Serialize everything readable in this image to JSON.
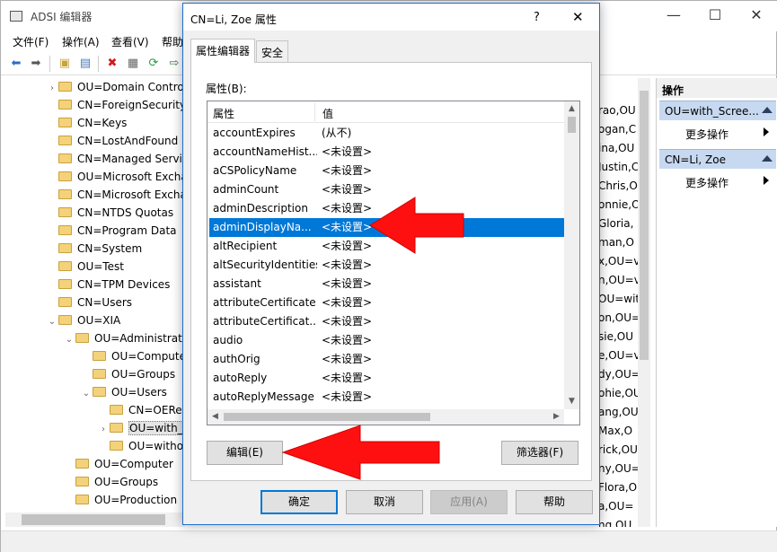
{
  "main_window": {
    "title": "ADSI 编辑器",
    "controls": {
      "minimize": "—",
      "maximize": "☐",
      "close": "✕"
    },
    "menu": [
      "文件(F)",
      "操作(A)",
      "查看(V)",
      "帮助"
    ]
  },
  "tree": {
    "items": [
      {
        "label": "OU=Domain Contro",
        "expand": "›"
      },
      {
        "label": "CN=ForeignSecurity",
        "expand": ""
      },
      {
        "label": "CN=Keys",
        "expand": ""
      },
      {
        "label": "CN=LostAndFound",
        "expand": ""
      },
      {
        "label": "CN=Managed Servi",
        "expand": ""
      },
      {
        "label": "OU=Microsoft Excha",
        "expand": ""
      },
      {
        "label": "CN=Microsoft Excha",
        "expand": ""
      },
      {
        "label": "CN=NTDS Quotas",
        "expand": ""
      },
      {
        "label": "CN=Program Data",
        "expand": ""
      },
      {
        "label": "CN=System",
        "expand": ""
      },
      {
        "label": "OU=Test",
        "expand": ""
      },
      {
        "label": "CN=TPM Devices",
        "expand": ""
      },
      {
        "label": "CN=Users",
        "expand": ""
      },
      {
        "label": "OU=XIA",
        "expand": "⌄"
      },
      {
        "label": "OU=Administratio",
        "expand": "⌄"
      },
      {
        "label": "OU=Compute",
        "expand": ""
      },
      {
        "label": "OU=Groups",
        "expand": ""
      },
      {
        "label": "OU=Users",
        "expand": "⌄"
      },
      {
        "label": "CN=OERe",
        "expand": ""
      },
      {
        "label": "OU=with_S",
        "expand": "›"
      },
      {
        "label": "OU=witho",
        "expand": ""
      },
      {
        "label": "OU=Computer",
        "expand": ""
      },
      {
        "label": "OU=Groups",
        "expand": ""
      },
      {
        "label": "OU=Production",
        "expand": ""
      }
    ]
  },
  "list": {
    "rows": [
      "rao,OU",
      "ogan,C",
      "ina,OU",
      "Justin,C",
      "Chris,OU",
      "onnie,O",
      "Gloria,",
      "man,O",
      "x,OU=v",
      "n,OU=v",
      "OU=wit",
      "on,OU=",
      "sie,OU",
      "e,OU=v",
      "dy,OU=",
      "ohie,OU",
      "ang,OU",
      "Max,O",
      "rick,OU",
      "ny,OU=",
      "Flora,O",
      "a,OU=",
      "ng,OU"
    ]
  },
  "actions": {
    "header": "操作",
    "sections": [
      {
        "title": "OU=with_Scree...",
        "item": "更多操作"
      },
      {
        "title": "CN=Li, Zoe",
        "item": "更多操作"
      }
    ]
  },
  "dialog": {
    "title": "CN=Li, Zoe 属性",
    "help": "?",
    "close": "✕",
    "tabs": [
      "属性编辑器",
      "安全"
    ],
    "attributes_label": "属性(B):",
    "columns": [
      "属性",
      "值"
    ],
    "rows": [
      {
        "name": "accountExpires",
        "value": "(从不)"
      },
      {
        "name": "accountNameHist...",
        "value": "<未设置>"
      },
      {
        "name": "aCSPolicyName",
        "value": "<未设置>"
      },
      {
        "name": "adminCount",
        "value": "<未设置>"
      },
      {
        "name": "adminDescription",
        "value": "<未设置>"
      },
      {
        "name": "adminDisplayNa...",
        "value": "<未设置>",
        "selected": true
      },
      {
        "name": "altRecipient",
        "value": "<未设置>"
      },
      {
        "name": "altSecurityIdentities",
        "value": "<未设置>"
      },
      {
        "name": "assistant",
        "value": "<未设置>"
      },
      {
        "name": "attributeCertificate",
        "value": "<未设置>"
      },
      {
        "name": "attributeCertificat...",
        "value": "<未设置>"
      },
      {
        "name": "audio",
        "value": "<未设置>"
      },
      {
        "name": "authOrig",
        "value": "<未设置>"
      },
      {
        "name": "autoReply",
        "value": "<未设置>"
      },
      {
        "name": "autoReplyMessage",
        "value": "<未设置>"
      }
    ],
    "buttons": {
      "edit": "编辑(E)",
      "filter": "筛选器(F)",
      "ok": "确定",
      "cancel": "取消",
      "apply": "应用(A)",
      "help": "帮助"
    }
  },
  "colors": {
    "selection": "#0078d7",
    "arrow_red": "#ff1010",
    "dialog_border": "#1d6fd0"
  }
}
